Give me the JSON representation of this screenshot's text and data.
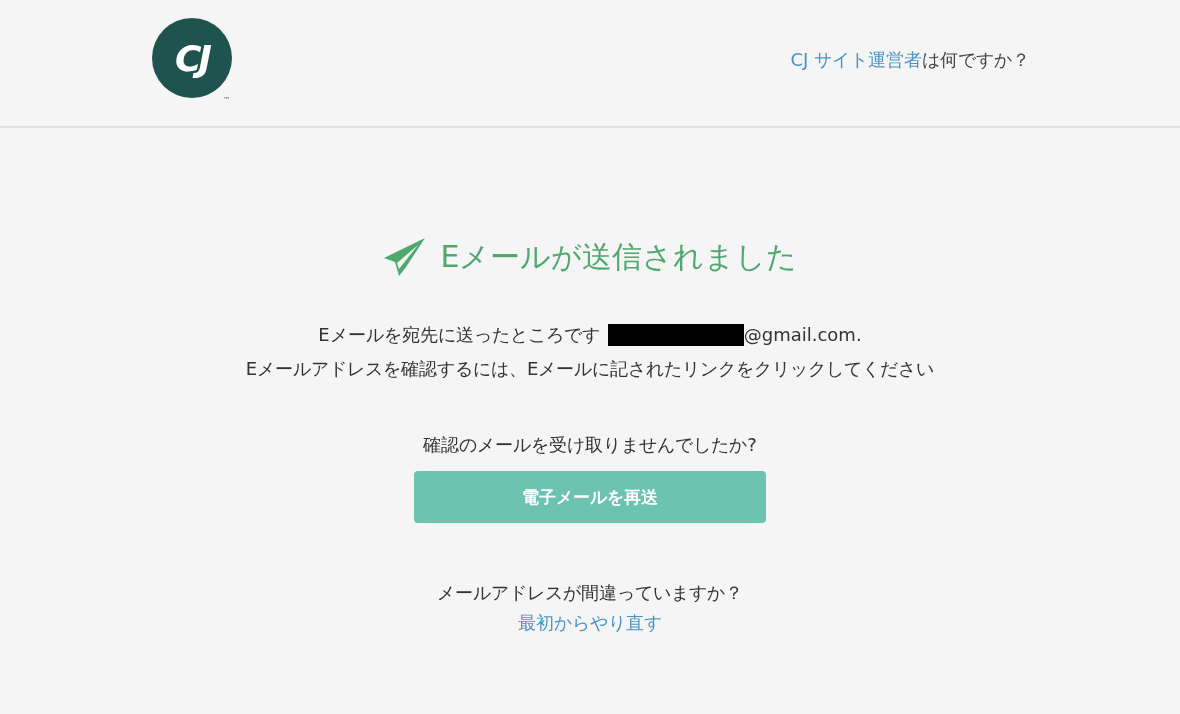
{
  "header": {
    "logo": {
      "text": "CJ",
      "trademark": "™"
    },
    "help": {
      "link": "CJ サイト運営者",
      "rest": "は何ですか？"
    }
  },
  "main": {
    "title": "Eメールが送信されました",
    "message": {
      "line1_prefix": "Eメールを宛先に送ったところです",
      "email_redacted": true,
      "email_suffix": "@gmail.com.",
      "line2": "Eメールアドレスを確認するには、Eメールに記されたリンクをクリックしてください"
    },
    "resend": {
      "question": "確認のメールを受け取りませんでしたか?",
      "button": "電子メールを再送"
    },
    "restart": {
      "question": "メールアドレスが間違っていますか？",
      "link": "最初からやり直す"
    }
  }
}
